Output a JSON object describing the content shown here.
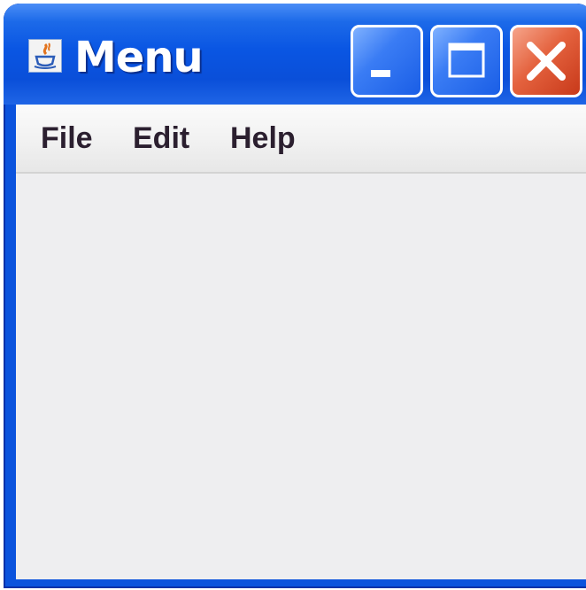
{
  "window": {
    "title": "Menu",
    "icon": "java-cup-icon",
    "controls": {
      "minimize": "minimize-icon",
      "maximize": "maximize-icon",
      "close": "close-icon"
    }
  },
  "menubar": {
    "items": [
      {
        "label": "File"
      },
      {
        "label": "Edit"
      },
      {
        "label": "Help"
      }
    ]
  },
  "colors": {
    "titlebar": "#0a56e3",
    "close_button": "#e4623e",
    "content_background": "#eeeef0"
  }
}
